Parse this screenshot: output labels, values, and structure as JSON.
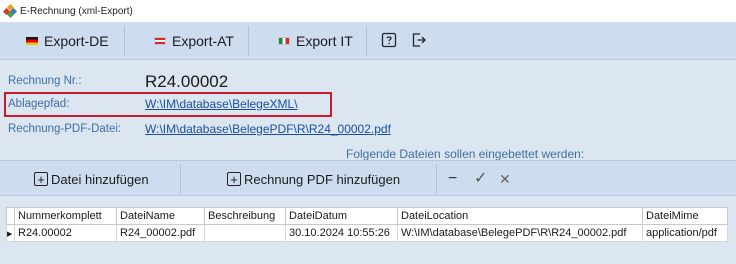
{
  "window": {
    "title": "E-Rechnung (xml-Export)"
  },
  "toolbar": {
    "export_de": "Export-DE",
    "export_at": "Export-AT",
    "export_it": "Export IT",
    "help_icon": "help-icon",
    "exit_icon": "exit-icon"
  },
  "form": {
    "invoice_label": "Rechnung Nr.:",
    "invoice_value": "R24.00002",
    "path_label": "Ablagepfad:",
    "path_value": "W:\\IM\\database\\BelegeXML\\",
    "pdf_label": "Rechnung-PDF-Datei:",
    "pdf_value": "W:\\IM\\database\\BelegePDF\\R\\R24_00002.pdf",
    "embed_label": "Folgende Dateien sollen eingebettet werden:"
  },
  "actions": {
    "add_file": "Datei hinzufügen",
    "add_pdf": "Rechnung PDF hinzufügen",
    "remove_glyph": "−",
    "confirm_glyph": "✓",
    "cancel_glyph": "✕"
  },
  "table": {
    "headers": [
      "Nummerkomplett",
      "DateiName",
      "Beschreibung",
      "DateiDatum",
      "DateiLocation",
      "DateiMime"
    ],
    "rows": [
      {
        "Nummerkomplett": "R24.00002",
        "DateiName": "R24_00002.pdf",
        "Beschreibung": "",
        "DateiDatum": "30.10.2024 10:55:26",
        "DateiLocation": "W:\\IM\\database\\BelegePDF\\R\\R24_00002.pdf",
        "DateiMime": "application/pdf"
      }
    ]
  },
  "colors": {
    "highlight": "#c8192e",
    "label": "#3f6ea3",
    "link": "#1a4fa0",
    "toolbar": "#cdddef",
    "background": "#dce6f1"
  }
}
